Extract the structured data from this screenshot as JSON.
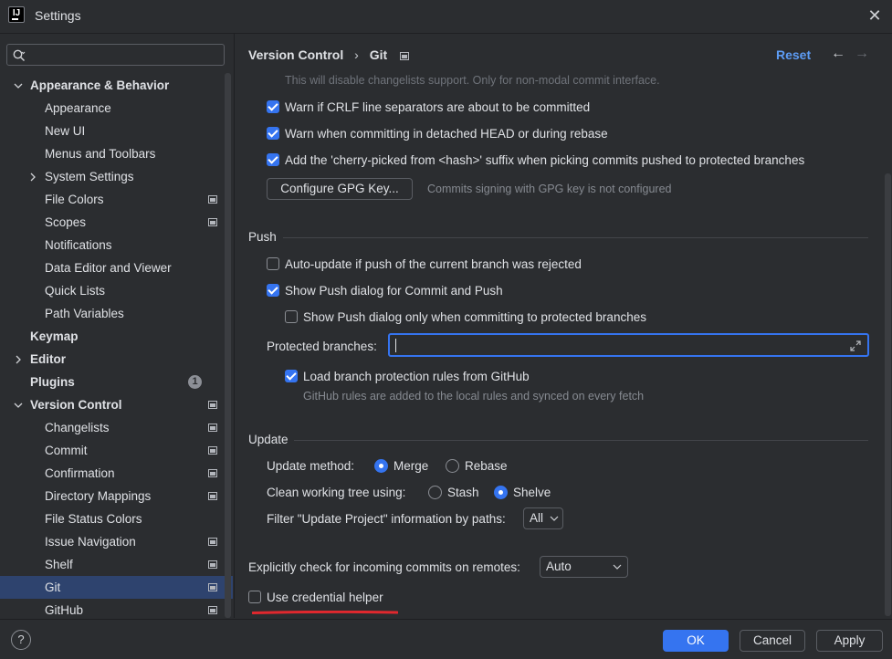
{
  "window": {
    "title": "Settings",
    "app_icon_text": "IJ"
  },
  "search": {
    "placeholder": ""
  },
  "sidebar": {
    "items": [
      {
        "label": "Appearance & Behavior"
      },
      {
        "label": "Appearance"
      },
      {
        "label": "New UI"
      },
      {
        "label": "Menus and Toolbars"
      },
      {
        "label": "System Settings"
      },
      {
        "label": "File Colors"
      },
      {
        "label": "Scopes"
      },
      {
        "label": "Notifications"
      },
      {
        "label": "Data Editor and Viewer"
      },
      {
        "label": "Quick Lists"
      },
      {
        "label": "Path Variables"
      },
      {
        "label": "Keymap"
      },
      {
        "label": "Editor"
      },
      {
        "label": "Plugins",
        "badge": "1"
      },
      {
        "label": "Version Control"
      },
      {
        "label": "Changelists"
      },
      {
        "label": "Commit"
      },
      {
        "label": "Confirmation"
      },
      {
        "label": "Directory Mappings"
      },
      {
        "label": "File Status Colors"
      },
      {
        "label": "Issue Navigation"
      },
      {
        "label": "Shelf"
      },
      {
        "label": "Git"
      },
      {
        "label": "GitHub"
      }
    ]
  },
  "header": {
    "crumb_parent": "Version Control",
    "crumb_sep": "›",
    "crumb_current": "Git",
    "reset": "Reset",
    "back": "←",
    "forward": "→"
  },
  "commit": {
    "faded_note": "This will disable changelists support. Only for non-modal commit interface.",
    "warn_crlf": {
      "label": "Warn if CRLF line separators are about to be committed",
      "checked": true
    },
    "warn_detached": {
      "label": "Warn when committing in detached HEAD or during rebase",
      "checked": true
    },
    "cherry_pick": {
      "label": "Add the 'cherry-picked from <hash>' suffix when picking commits pushed to protected branches",
      "checked": true
    },
    "gpg_button": "Configure GPG Key...",
    "gpg_status": "Commits signing with GPG key is not configured"
  },
  "push": {
    "title": "Push",
    "auto_update": {
      "label": "Auto-update if push of the current branch was rejected",
      "checked": false
    },
    "show_push_dialog": {
      "label": "Show Push dialog for Commit and Push",
      "checked": true
    },
    "show_push_protected": {
      "label": "Show Push dialog only when committing to protected branches",
      "checked": false
    },
    "protected_label": "Protected branches:",
    "protected_value": "",
    "load_rules": {
      "label": "Load branch protection rules from GitHub",
      "checked": true
    },
    "rules_hint": "GitHub rules are added to the local rules and synced on every fetch"
  },
  "update": {
    "title": "Update",
    "method_label": "Update method:",
    "method_options": [
      "Merge",
      "Rebase"
    ],
    "method_selected": "Merge",
    "clean_label": "Clean working tree using:",
    "clean_options": [
      "Stash",
      "Shelve"
    ],
    "clean_selected": "Shelve",
    "filter_label": "Filter \"Update Project\" information by paths:",
    "filter_value": "All"
  },
  "incoming": {
    "label": "Explicitly check for incoming commits on remotes:",
    "value": "Auto"
  },
  "credential": {
    "label": "Use credential helper",
    "checked": false
  },
  "footer": {
    "help": "?",
    "ok": "OK",
    "cancel": "Cancel",
    "apply": "Apply"
  },
  "colors": {
    "accent": "#3574f0",
    "link": "#5d9cf5",
    "selection": "#2e436e",
    "highlight": "#e0282e"
  }
}
